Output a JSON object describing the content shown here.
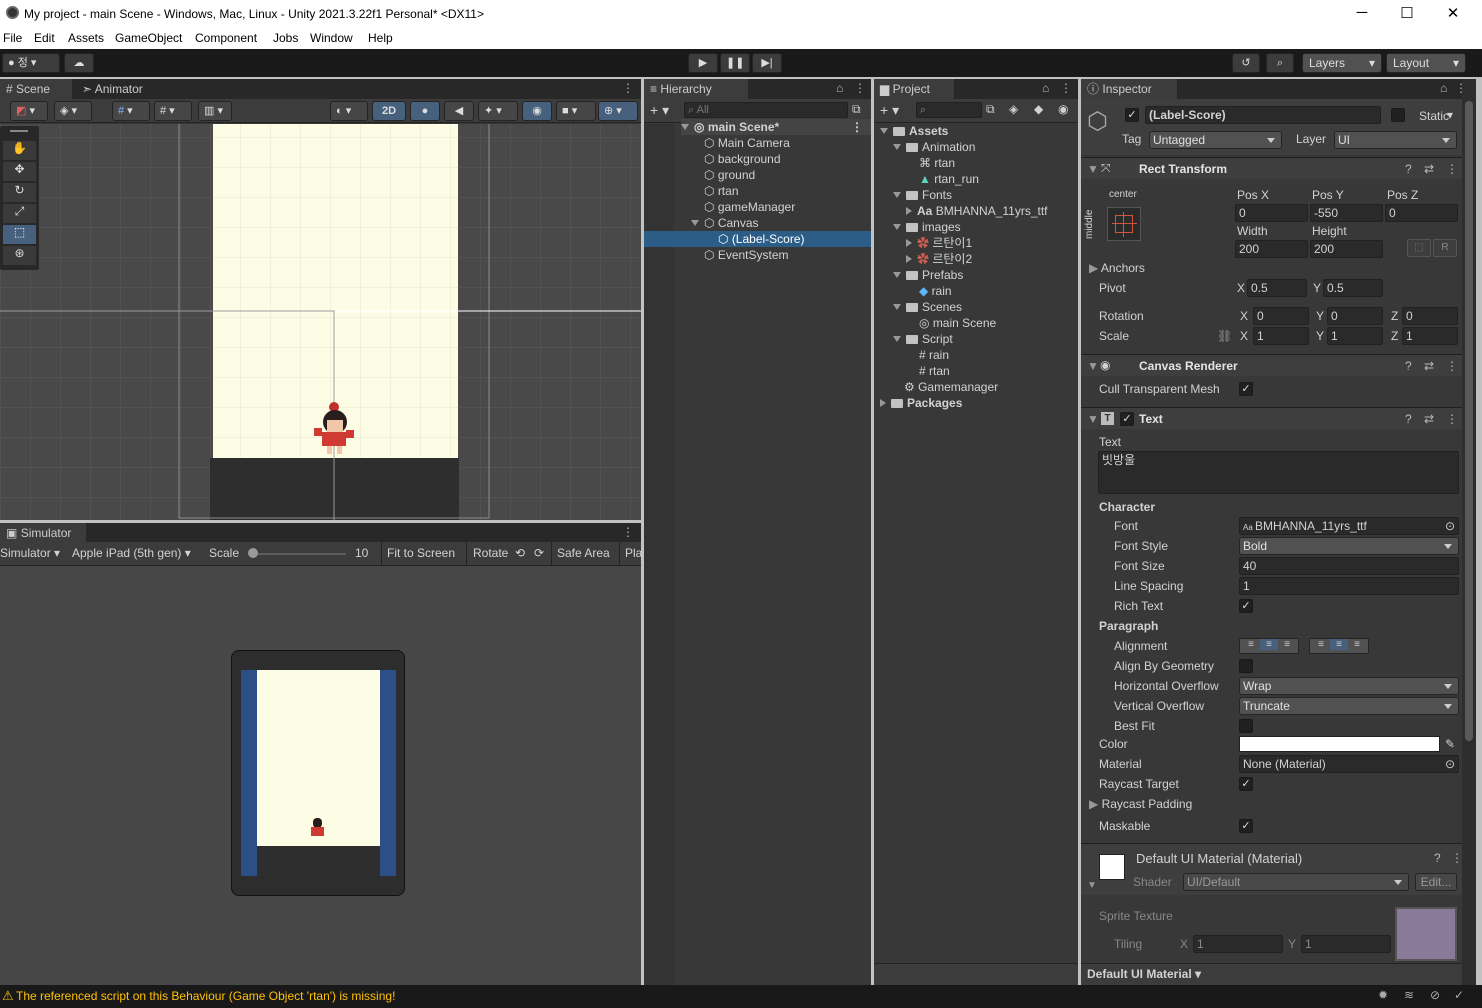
{
  "window": {
    "title": "My project - main Scene - Windows, Mac, Linux - Unity 2021.3.22f1 Personal* <DX11>",
    "minimize": "─",
    "maximize": "☐",
    "close": "✕"
  },
  "menu": [
    "File",
    "Edit",
    "Assets",
    "GameObject",
    "Component",
    "Jobs",
    "Window",
    "Help"
  ],
  "toolbar": {
    "account": "정",
    "layers": "Layers",
    "layout": "Layout"
  },
  "scene": {
    "tab_scene": "Scene",
    "tab_animator": "Animator",
    "btn_2d": "2D"
  },
  "simulator": {
    "tab": "Simulator",
    "mode": "Simulator",
    "device": "Apple iPad (5th gen)",
    "scale_label": "Scale",
    "scale_value": "10",
    "fit": "Fit to Screen",
    "rotate": "Rotate",
    "safe_area": "Safe Area",
    "play": "Pla"
  },
  "hierarchy": {
    "tab": "Hierarchy",
    "search_placeholder": "All",
    "scene": "main Scene*",
    "items": [
      "Main Camera",
      "background",
      "ground",
      "rtan",
      "gameManager",
      "Canvas",
      "(Label-Score)",
      "EventSystem"
    ]
  },
  "project": {
    "tab": "Project",
    "assets": "Assets",
    "animation": "Animation",
    "anim_items": [
      "rtan",
      "rtan_run"
    ],
    "fonts": "Fonts",
    "font_item": "BMHANNA_11yrs_ttf",
    "images": "images",
    "image_items": [
      "르탄이1",
      "르탄이2"
    ],
    "prefabs": "Prefabs",
    "prefab_item": "rain",
    "scenes": "Scenes",
    "scene_item": "main Scene",
    "script": "Script",
    "script_items": [
      "rain",
      "rtan"
    ],
    "gamemanager": "Gamemanager",
    "packages": "Packages"
  },
  "inspector": {
    "tab": "Inspector",
    "name": "(Label-Score)",
    "static": "Static",
    "tag_label": "Tag",
    "tag": "Untagged",
    "layer_label": "Layer",
    "layer": "UI",
    "rect": {
      "title": "Rect Transform",
      "anchor_h": "center",
      "anchor_v": "middle",
      "posx_label": "Pos X",
      "posy_label": "Pos Y",
      "posz_label": "Pos Z",
      "posx": "0",
      "posy": "-550",
      "posz": "0",
      "width_label": "Width",
      "height_label": "Height",
      "width": "200",
      "height": "200",
      "r_btn": "R",
      "anchors": "Anchors",
      "pivot_label": "Pivot",
      "pivot_x": "0.5",
      "pivot_y": "0.5",
      "rotation_label": "Rotation",
      "rot_x": "0",
      "rot_y": "0",
      "rot_z": "0",
      "scale_label": "Scale",
      "scale_x": "1",
      "scale_y": "1",
      "scale_z": "1",
      "x": "X",
      "y": "Y",
      "z": "Z"
    },
    "canvas_renderer": {
      "title": "Canvas Renderer",
      "cull": "Cull Transparent Mesh"
    },
    "text": {
      "title": "Text",
      "text_label": "Text",
      "text_value": "빗방울",
      "character": "Character",
      "font_label": "Font",
      "font": "BMHANNA_11yrs_ttf",
      "font_style_label": "Font Style",
      "font_style": "Bold",
      "font_size_label": "Font Size",
      "font_size": "40",
      "line_spacing_label": "Line Spacing",
      "line_spacing": "1",
      "rich_text_label": "Rich Text",
      "paragraph": "Paragraph",
      "alignment_label": "Alignment",
      "align_geom_label": "Align By Geometry",
      "h_overflow_label": "Horizontal Overflow",
      "h_overflow": "Wrap",
      "v_overflow_label": "Vertical Overflow",
      "v_overflow": "Truncate",
      "best_fit_label": "Best Fit",
      "color_label": "Color",
      "material_label": "Material",
      "material": "None (Material)",
      "raycast_target_label": "Raycast Target",
      "raycast_padding_label": "Raycast Padding",
      "maskable_label": "Maskable"
    },
    "material": {
      "title": "Default UI Material (Material)",
      "shader_label": "Shader",
      "shader": "UI/Default",
      "edit": "Edit...",
      "sprite_texture": "Sprite Texture",
      "tiling": "Tiling",
      "tiling_x": "1",
      "tiling_y": "1"
    },
    "footer": "Default UI Material"
  },
  "status": {
    "message": "The referenced script on this Behaviour (Game Object 'rtan') is missing!"
  },
  "colors": {
    "accent": "#2c5d87",
    "warning": "#ffc107",
    "scene_bg": "#fdfde6"
  }
}
